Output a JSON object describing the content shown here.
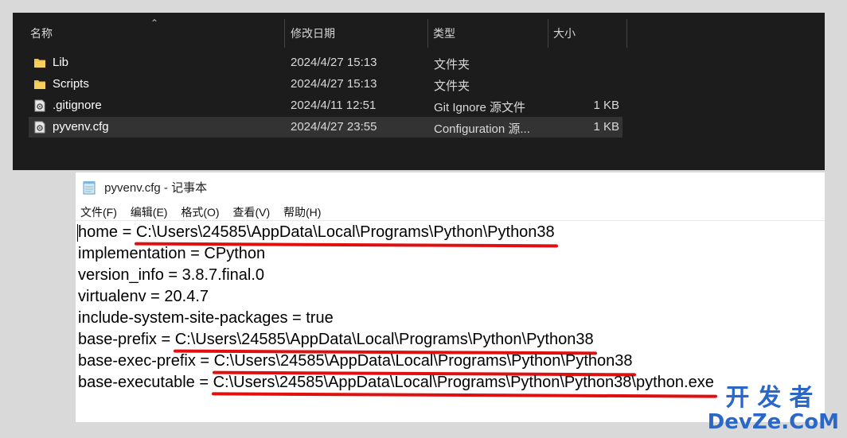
{
  "explorer": {
    "columns": {
      "name": "名称",
      "modified": "修改日期",
      "type": "类型",
      "size": "大小"
    },
    "files": [
      {
        "icon": "folder-icon",
        "name": "Lib",
        "modified": "2024/4/27 15:13",
        "type": "文件夹",
        "size": ""
      },
      {
        "icon": "folder-icon",
        "name": "Scripts",
        "modified": "2024/4/27 15:13",
        "type": "文件夹",
        "size": ""
      },
      {
        "icon": "config-file-icon",
        "name": ".gitignore",
        "modified": "2024/4/11 12:51",
        "type": "Git Ignore 源文件",
        "size": "1 KB"
      },
      {
        "icon": "config-file-icon",
        "name": "pyvenv.cfg",
        "modified": "2024/4/27 23:55",
        "type": "Configuration 源...",
        "size": "1 KB",
        "selected": true
      }
    ]
  },
  "notepad": {
    "title": "pyvenv.cfg - 记事本",
    "menu": [
      "文件(F)",
      "编辑(E)",
      "格式(O)",
      "查看(V)",
      "帮助(H)"
    ],
    "lines": [
      {
        "key": "home = ",
        "value": "C:\\Users\\24585\\AppData\\Local\\Programs\\Python\\Python38",
        "highlight": true
      },
      {
        "key": "implementation = ",
        "value": "CPython",
        "highlight": false
      },
      {
        "key": "version_info = ",
        "value": "3.8.7.final.0",
        "highlight": false
      },
      {
        "key": "virtualenv = ",
        "value": "20.4.7",
        "highlight": false
      },
      {
        "key": "include-system-site-packages = ",
        "value": "true",
        "highlight": false
      },
      {
        "key": "base-prefix = ",
        "value": "C:\\Users\\24585\\AppData\\Local\\Programs\\Python\\Python38",
        "highlight": true
      },
      {
        "key": "base-exec-prefix = ",
        "value": "C:\\Users\\24585\\AppData\\Local\\Programs\\Python\\Python38",
        "highlight": true
      },
      {
        "key": "base-executable = ",
        "value": "C:\\Users\\24585\\AppData\\Local\\Programs\\Python\\Python38\\python.exe",
        "highlight": true
      }
    ]
  },
  "watermark": {
    "cn": "开发者",
    "en": "DevZe.CoM"
  },
  "colors": {
    "explorer_bg": "#1c1c1c",
    "selected_row": "#333333",
    "underline": "#e01010",
    "watermark": "#2a67c9"
  }
}
